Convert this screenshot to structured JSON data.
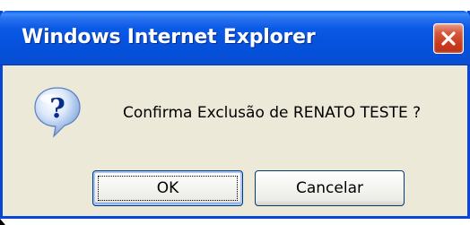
{
  "window": {
    "title": "Windows Internet Explorer"
  },
  "dialog": {
    "icon": "question-icon",
    "message": "Confirma Exclusão de RENATO TESTE ?",
    "buttons": {
      "ok_label": "OK",
      "cancel_label": "Cancelar"
    }
  },
  "colors": {
    "titlebar_blue": "#0653de",
    "dialog_background": "#ece9d8",
    "close_button_red": "#c93a1c",
    "button_border": "#003c74"
  }
}
